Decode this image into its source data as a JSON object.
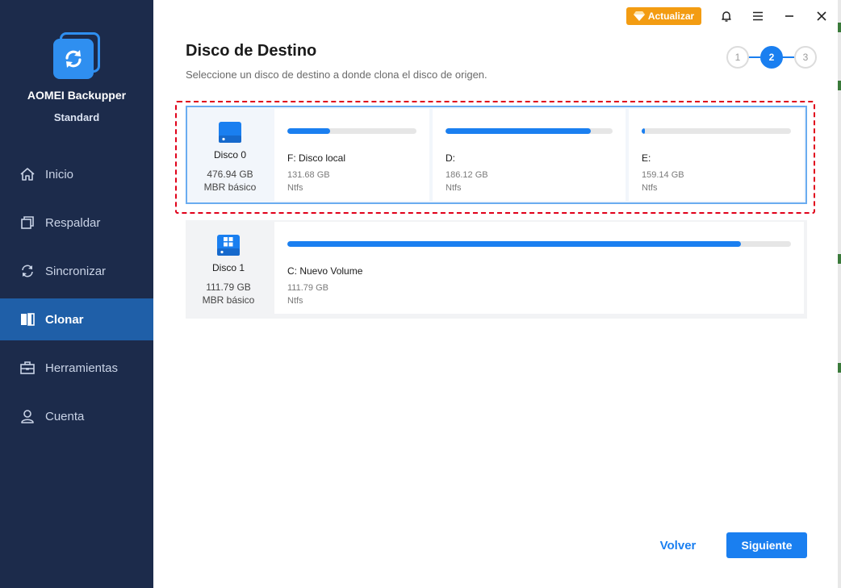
{
  "app": {
    "name": "AOMEI Backupper",
    "edition": "Standard"
  },
  "topbar": {
    "upgrade_label": "Actualizar",
    "icons": [
      "bell-icon",
      "menu-icon",
      "minimize-icon",
      "close-icon"
    ]
  },
  "sidebar": {
    "items": [
      {
        "label": "Inicio",
        "icon": "home-icon",
        "active": false
      },
      {
        "label": "Respaldar",
        "icon": "backup-icon",
        "active": false
      },
      {
        "label": "Sincronizar",
        "icon": "sync-icon",
        "active": false
      },
      {
        "label": "Clonar",
        "icon": "clone-icon",
        "active": true
      },
      {
        "label": "Herramientas",
        "icon": "toolbox-icon",
        "active": false
      },
      {
        "label": "Cuenta",
        "icon": "user-icon",
        "active": false
      }
    ]
  },
  "header": {
    "title": "Disco de Destino",
    "subtitle": "Seleccione un disco de destino a donde clona el disco de origen."
  },
  "steps": {
    "items": [
      "1",
      "2",
      "3"
    ],
    "current": 2
  },
  "disks": [
    {
      "name": "Disco 0",
      "size": "476.94 GB",
      "type": "MBR básico",
      "selected": true,
      "partitions": [
        {
          "label": "F: Disco local",
          "size": "131.68 GB",
          "fs": "Ntfs",
          "used_fraction": 0.33
        },
        {
          "label": "D:",
          "size": "186.12 GB",
          "fs": "Ntfs",
          "used_fraction": 0.87
        },
        {
          "label": "E:",
          "size": "159.14 GB",
          "fs": "Ntfs",
          "used_fraction": 0.02
        }
      ]
    },
    {
      "name": "Disco 1",
      "size": "111.79 GB",
      "type": "MBR básico",
      "selected": false,
      "partitions": [
        {
          "label": "C: Nuevo Volume",
          "size": "111.79 GB",
          "fs": "Ntfs",
          "used_fraction": 0.9
        }
      ]
    }
  ],
  "footer": {
    "back_label": "Volver",
    "next_label": "Siguiente"
  },
  "colors": {
    "sidebar_bg": "#1c2b4b",
    "sidebar_active": "#1f5fa8",
    "accent": "#1a7ff0",
    "upgrade": "#f39c12",
    "highlight_frame": "#e0001a"
  }
}
